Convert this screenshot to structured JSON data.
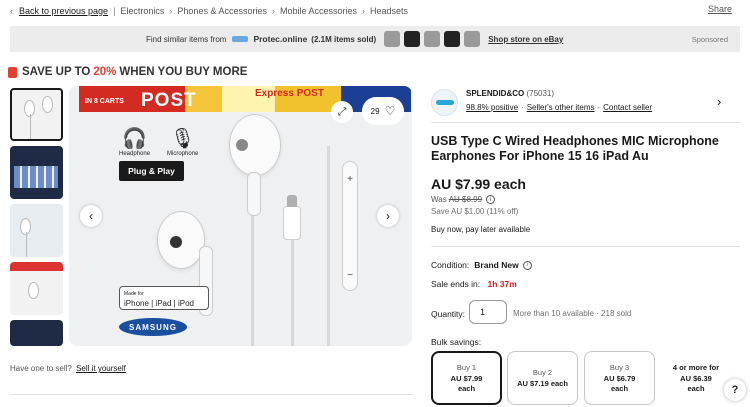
{
  "breadcrumb": {
    "back": "Back to previous page",
    "items": [
      "Electronics",
      "Phones & Accessories",
      "Mobile Accessories",
      "Headsets"
    ]
  },
  "share": "Share",
  "banner": {
    "find_text": "Find similar items from",
    "store": "Protec.online",
    "count": "(2.1M items sold)",
    "shop_link": "Shop store on eBay",
    "sponsored": "Sponsored"
  },
  "promo": {
    "prefix": "SAVE UP TO",
    "percent": "20%",
    "suffix": "WHEN YOU BUY MORE"
  },
  "gallery": {
    "cart_label": "IN 8 CARTS",
    "post_text": "POST",
    "express_text": "Express POST",
    "watch_count": "29",
    "headphone_label": "Headphone",
    "microphone_label": "Microphone",
    "plug_play": "Plug & Play",
    "made_for_small": "Made for",
    "made_for": "iPhone | iPad | iPod",
    "samsung": "SAMSUNG"
  },
  "sell": {
    "text": "Have one to sell?",
    "link": "Sell it yourself"
  },
  "seller": {
    "name": "SPLENDID&CO",
    "feedback_count": "(75031)",
    "positive": "98.8% positive",
    "other_items": "Seller's other items",
    "contact": "Contact seller"
  },
  "listing": {
    "title": "USB Type C Wired Headphones MIC Microphone Earphones For iPhone 15 16 iPad Au",
    "price": "AU $7.99 each",
    "was_label": "Was",
    "was_price": "AU $8.99",
    "saved": "Save AU $1.00 (11% off)",
    "bnpl": "Buy now, pay later available",
    "condition_label": "Condition:",
    "condition": "Brand New",
    "sale_label": "Sale ends in:",
    "sale_timer": "1h 37m",
    "quantity_label": "Quantity:",
    "quantity_value": "1",
    "availability": "More than 10 available · 218 sold",
    "bulk_label": "Bulk savings:",
    "bulk": [
      {
        "qty": "Buy 1",
        "price": "AU $7.99",
        "unit": "each"
      },
      {
        "qty": "Buy 2",
        "price": "AU $7.19 each",
        "unit": ""
      },
      {
        "qty": "Buy 3",
        "price": "AU $6.79",
        "unit": "each"
      },
      {
        "qty": "4 or more for",
        "price": "AU $6.39",
        "unit": "each"
      }
    ]
  },
  "help": "?"
}
